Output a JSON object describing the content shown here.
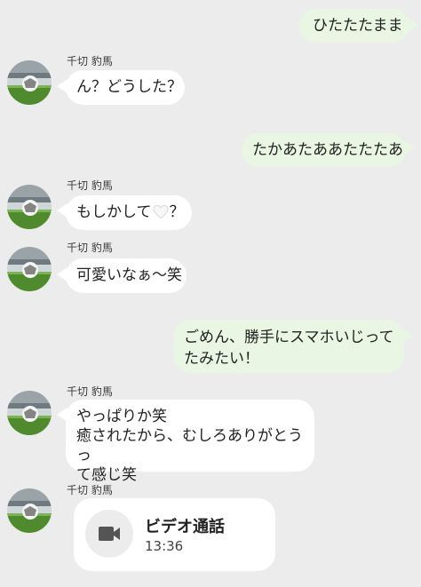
{
  "contact_name": "千切 豹馬",
  "messages": [
    {
      "side": "out",
      "text": "ひたたたまま"
    },
    {
      "side": "in",
      "sender": "千切 豹馬",
      "text": "ん？どうした？"
    },
    {
      "side": "out",
      "text": "たかあたああたたたあ"
    },
    {
      "side": "in",
      "sender": "千切 豹馬",
      "text_before": "もしかして",
      "emoji": "white-heart-icon",
      "text_after": "？"
    },
    {
      "side": "in",
      "sender": "千切 豹馬",
      "text": "可愛いなぁ〜笑"
    },
    {
      "side": "out",
      "lines": [
        "ごめん、勝手にスマホいじって",
        "たみたい！"
      ]
    },
    {
      "side": "in",
      "sender": "千切 豹馬",
      "lines": [
        "やっぱりか笑",
        "癒されたから、むしろありがとうっ",
        "て感じ笑"
      ]
    },
    {
      "side": "in",
      "sender": "千切 豹馬",
      "type": "video_call",
      "title": "ビデオ通話",
      "duration": "13:36",
      "icon": "video-camera-icon"
    }
  ],
  "colors": {
    "background": "#ececec",
    "outgoing_bubble": "#e9f6e3",
    "incoming_bubble": "#ffffff",
    "avatar_turf": "#4f8a2e"
  }
}
